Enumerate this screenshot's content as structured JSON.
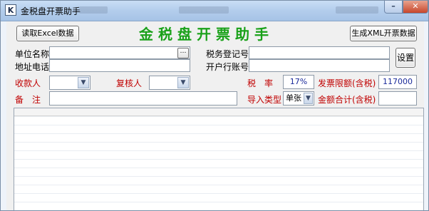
{
  "window": {
    "title": "金税盘开票助手",
    "app_icon_letter": "K",
    "minimize_symbol": "–",
    "close_symbol": "✕"
  },
  "toolbar": {
    "read_excel_label": "读取Excel数据",
    "generate_xml_label": "生成XML开票数据",
    "heading": "金税盘开票助手",
    "settings_label": "设置"
  },
  "form": {
    "company_name_label": "单位名称",
    "company_name_value": "",
    "address_phone_label": "地址电话",
    "address_phone_value": "",
    "tax_id_label": "税务登记号",
    "tax_id_value": "",
    "bank_account_label": "开户行账号",
    "bank_account_value": "",
    "payee_label": "收款人",
    "payee_value": "",
    "reviewer_label": "复核人",
    "reviewer_value": "",
    "tax_rate_label": "税　率",
    "tax_rate_value": "17%",
    "invoice_limit_label": "发票限额(含税)",
    "invoice_limit_value": "117000",
    "remark_label": "备　注",
    "remark_value": "",
    "import_type_label": "导入类型",
    "import_type_value": "单张",
    "total_amount_label": "金额合计(含税)",
    "total_amount_value": ""
  },
  "icons": {
    "ellipsis": "…",
    "dropdown": "▼"
  },
  "colors": {
    "heading_green": "#1aa11a",
    "label_red": "#c00000"
  }
}
